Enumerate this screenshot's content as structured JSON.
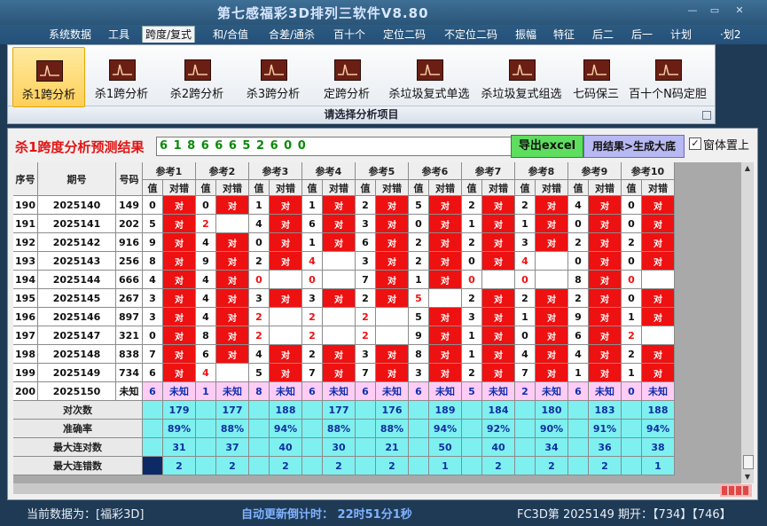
{
  "app_title": "第七感福彩3D排列三软件V8.80",
  "window_controls": [
    "—",
    "▭",
    "✕"
  ],
  "menu": [
    "系统数据",
    "工具",
    "跨度/复式",
    "和/合值",
    "合差/通杀",
    "百十个",
    "定位二码",
    "不定位二码",
    "振幅",
    "特征",
    "后二",
    "后一",
    "计划",
    "·划2"
  ],
  "menu_active": 2,
  "ribbon": {
    "buttons": [
      "杀1跨分析",
      "杀1跨分析",
      "杀2跨分析",
      "杀3跨分析",
      "定跨分析",
      "杀垃圾复式单选",
      "杀垃圾复式组选",
      "七码保三",
      "百十个N码定胆"
    ],
    "selected": 0,
    "caption": "请选择分析项目"
  },
  "result": {
    "title": "杀1跨度分析预测结果",
    "value": "6 1 8 6 6 6 5 2 6 0 0",
    "export_button": "导出excel",
    "generate_button": "用结果>生成大底",
    "topmost_checkbox": "✓",
    "topmost_label": "窗体置上"
  },
  "table": {
    "headers": {
      "seq": "序号",
      "period": "期号",
      "number": "号码",
      "value": "值",
      "check": "对错"
    },
    "refs": [
      "参考1",
      "参考2",
      "参考3",
      "参考4",
      "参考5",
      "参考6",
      "参考7",
      "参考8",
      "参考9",
      "参考10"
    ],
    "rows": [
      {
        "seq": "190",
        "period": "2025140",
        "num": "149",
        "vals": [
          "0",
          "0",
          "1",
          "1",
          "2",
          "5",
          "2",
          "2",
          "4",
          "0"
        ],
        "res": [
          "对",
          "对",
          "对",
          "对",
          "对",
          "对",
          "对",
          "对",
          "对",
          "对"
        ]
      },
      {
        "seq": "191",
        "period": "2025141",
        "num": "202",
        "vals": [
          "5",
          "2",
          "4",
          "6",
          "3",
          "0",
          "1",
          "1",
          "0",
          "0"
        ],
        "res": [
          "对",
          "",
          "对",
          "对",
          "对",
          "对",
          "对",
          "对",
          "对",
          "对"
        ]
      },
      {
        "seq": "192",
        "period": "2025142",
        "num": "916",
        "vals": [
          "9",
          "4",
          "0",
          "1",
          "6",
          "2",
          "2",
          "3",
          "2",
          "2"
        ],
        "res": [
          "对",
          "对",
          "对",
          "对",
          "对",
          "对",
          "对",
          "对",
          "对",
          "对"
        ]
      },
      {
        "seq": "193",
        "period": "2025143",
        "num": "256",
        "vals": [
          "8",
          "9",
          "2",
          "4",
          "3",
          "2",
          "0",
          "4",
          "0",
          "0"
        ],
        "res": [
          "对",
          "对",
          "对",
          "",
          "对",
          "对",
          "对",
          "",
          "对",
          "对"
        ]
      },
      {
        "seq": "194",
        "period": "2025144",
        "num": "666",
        "vals": [
          "4",
          "4",
          "0",
          "0",
          "7",
          "1",
          "0",
          "0",
          "8",
          "0"
        ],
        "res": [
          "对",
          "对",
          "",
          "",
          "对",
          "对",
          "",
          "",
          "对",
          ""
        ]
      },
      {
        "seq": "195",
        "period": "2025145",
        "num": "267",
        "vals": [
          "3",
          "4",
          "3",
          "3",
          "2",
          "5",
          "2",
          "2",
          "2",
          "0"
        ],
        "res": [
          "对",
          "对",
          "对",
          "对",
          "对",
          "",
          "对",
          "对",
          "对",
          "对"
        ]
      },
      {
        "seq": "196",
        "period": "2025146",
        "num": "897",
        "vals": [
          "3",
          "4",
          "2",
          "2",
          "2",
          "5",
          "3",
          "1",
          "9",
          "1"
        ],
        "res": [
          "对",
          "对",
          "",
          "",
          "",
          "对",
          "对",
          "对",
          "对",
          "对"
        ]
      },
      {
        "seq": "197",
        "period": "2025147",
        "num": "321",
        "vals": [
          "0",
          "8",
          "2",
          "2",
          "2",
          "9",
          "1",
          "0",
          "6",
          "2"
        ],
        "res": [
          "对",
          "对",
          "",
          "",
          "",
          "对",
          "对",
          "对",
          "对",
          ""
        ]
      },
      {
        "seq": "198",
        "period": "2025148",
        "num": "838",
        "vals": [
          "7",
          "6",
          "4",
          "2",
          "3",
          "8",
          "1",
          "4",
          "4",
          "2"
        ],
        "res": [
          "对",
          "对",
          "对",
          "对",
          "对",
          "对",
          "对",
          "对",
          "对",
          "对"
        ]
      },
      {
        "seq": "199",
        "period": "2025149",
        "num": "734",
        "vals": [
          "6",
          "4",
          "5",
          "7",
          "7",
          "3",
          "2",
          "7",
          "1",
          "1"
        ],
        "res": [
          "对",
          "",
          "对",
          "对",
          "对",
          "对",
          "对",
          "对",
          "对",
          "对"
        ]
      }
    ],
    "pending_row": {
      "seq": "200",
      "period": "2025150",
      "num": "未知",
      "vals": [
        "6",
        "1",
        "8",
        "6",
        "6",
        "6",
        "5",
        "2",
        "6",
        "0"
      ],
      "res": [
        "未知",
        "未知",
        "未知",
        "未知",
        "未知",
        "未知",
        "未知",
        "未知",
        "未知",
        "未知"
      ]
    },
    "stats": [
      {
        "label": "对次数",
        "values": [
          "179",
          "177",
          "188",
          "177",
          "176",
          "189",
          "184",
          "180",
          "183",
          "188"
        ]
      },
      {
        "label": "准确率",
        "values": [
          "89%",
          "88%",
          "94%",
          "88%",
          "88%",
          "94%",
          "92%",
          "90%",
          "91%",
          "94%"
        ]
      },
      {
        "label": "最大连对数",
        "values": [
          "31",
          "37",
          "40",
          "30",
          "21",
          "50",
          "40",
          "34",
          "36",
          "38"
        ]
      },
      {
        "label": "最大连错数",
        "values": [
          "2",
          "2",
          "2",
          "2",
          "2",
          "1",
          "2",
          "2",
          "2",
          "1"
        ]
      }
    ]
  },
  "status": {
    "left": "当前数据为：[福彩3D]",
    "middle": "自动更新倒计时：  22时51分1秒",
    "right": "FC3D第 2025149 期开：【734】【746】"
  },
  "colors": {
    "hit": "#ee1111",
    "pending": "#ffccf6",
    "stat": "#7ef0f0",
    "accent": "#e41414"
  }
}
